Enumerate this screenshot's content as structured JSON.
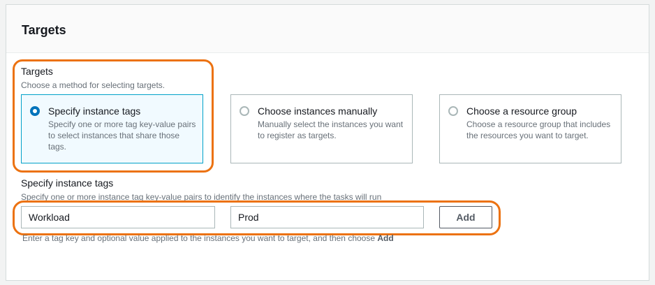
{
  "panel": {
    "title": "Targets"
  },
  "targets": {
    "label": "Targets",
    "description": "Choose a method for selecting targets.",
    "options": [
      {
        "title": "Specify instance tags",
        "description": "Specify one or more tag key-value pairs to select instances that share those tags.",
        "selected": true
      },
      {
        "title": "Choose instances manually",
        "description": "Manually select the instances you want to register as targets.",
        "selected": false
      },
      {
        "title": "Choose a resource group",
        "description": "Choose a resource group that includes the resources you want to target.",
        "selected": false
      }
    ]
  },
  "tags": {
    "label": "Specify instance tags",
    "description": "Specify one or more instance tag key-value pairs to identify the instances where the tasks will run",
    "key_value": "Workload",
    "value_value": "Prod",
    "add_label": "Add",
    "help_prefix": "Enter a tag key and optional value applied to the instances you want to target, and then choose ",
    "help_bold": "Add"
  },
  "colors": {
    "highlight": "#ec7211",
    "accent": "#0073bb",
    "selected_border": "#00a1c9"
  }
}
